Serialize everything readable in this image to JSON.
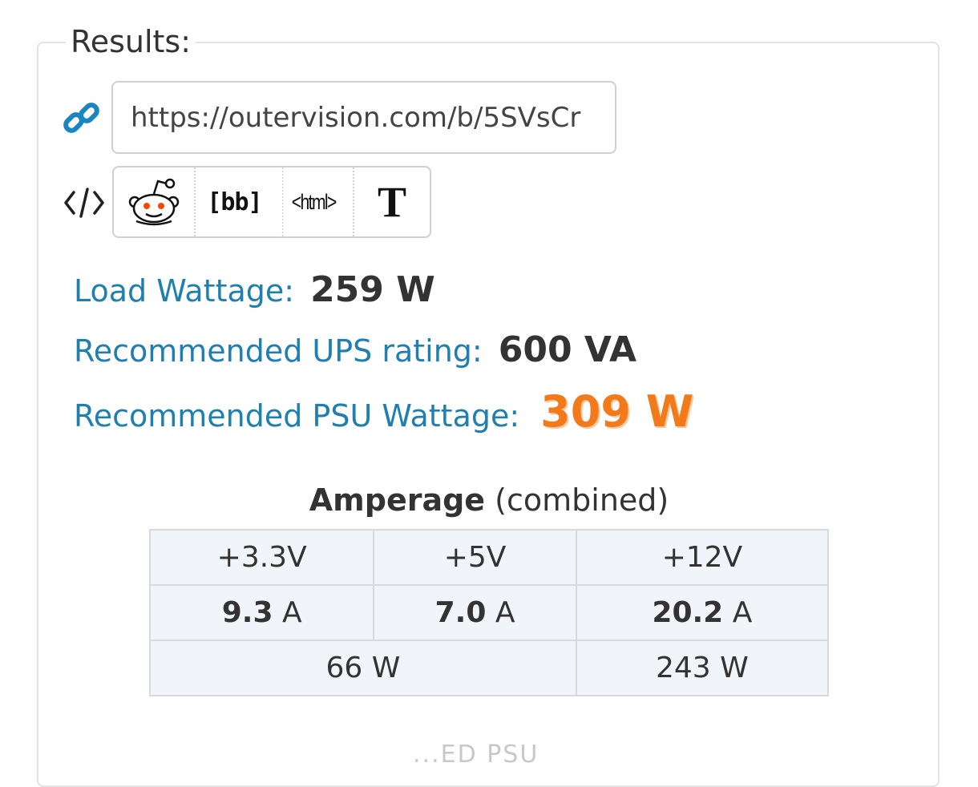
{
  "results": {
    "legend": "Results:",
    "share_url": "https://outervision.com/b/5SVsCr",
    "share_buttons": {
      "bb_label": "[bb]",
      "html_label": "<html>",
      "text_label": "T"
    }
  },
  "stats": {
    "load_wattage_label": "Load Wattage:",
    "load_wattage_value": "259 W",
    "ups_label": "Recommended UPS rating:",
    "ups_value": "600 VA",
    "psu_label": "Recommended PSU Wattage:",
    "psu_value": "309 W"
  },
  "amperage": {
    "title_bold": "Amperage",
    "title_rest": "(combined)",
    "rails": [
      "+3.3V",
      "+5V",
      "+12V"
    ],
    "currents": [
      {
        "value": "9.3",
        "unit": "A"
      },
      {
        "value": "7.0",
        "unit": "A"
      },
      {
        "value": "20.2",
        "unit": "A"
      }
    ],
    "power": {
      "low_rails": "66 W",
      "rail_12v": "243 W"
    }
  },
  "cutoff_text": "...ED PSU",
  "colors": {
    "label_blue": "#1f7fb0",
    "psu_orange": "#f27a1a",
    "table_bg": "#f1f4f9"
  }
}
